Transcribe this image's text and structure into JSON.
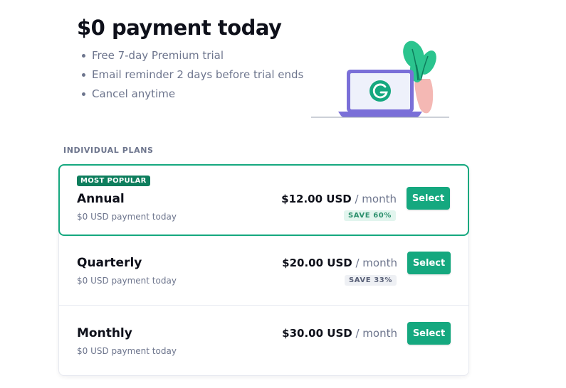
{
  "hero": {
    "title": "$0 payment today",
    "benefits": [
      "Free 7-day Premium trial",
      "Email reminder 2 days before trial ends",
      "Cancel anytime"
    ]
  },
  "section_label": "INDIVIDUAL PLANS",
  "plans": [
    {
      "badge": "MOST POPULAR",
      "name": "Annual",
      "subtitle": "$0 USD payment today",
      "price": "$12.00 USD",
      "period": "/ month",
      "save": "SAVE 60%",
      "button": "Select"
    },
    {
      "name": "Quarterly",
      "subtitle": "$0 USD payment today",
      "price": "$20.00 USD",
      "period": "/ month",
      "save": "SAVE 33%",
      "button": "Select"
    },
    {
      "name": "Monthly",
      "subtitle": "$0 USD payment today",
      "price": "$30.00 USD",
      "period": "/ month",
      "button": "Select"
    }
  ],
  "colors": {
    "accent": "#15a87f",
    "badge": "#0e7e5d",
    "text": "#0e101a",
    "muted": "#6d758d"
  }
}
